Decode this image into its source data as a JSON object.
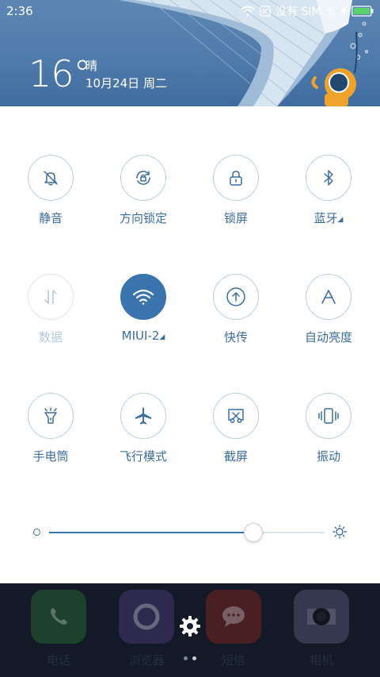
{
  "status_bar": {
    "time": "2:36",
    "carrier": "没有 SIM 卡"
  },
  "weather": {
    "temperature": "16°",
    "condition": "晴",
    "date": "10月24日 周二"
  },
  "toggles": [
    {
      "label": "静音",
      "icon": "bell-muted-icon",
      "state": "off"
    },
    {
      "label": "方向锁定",
      "icon": "rotation-lock-icon",
      "state": "off"
    },
    {
      "label": "锁屏",
      "icon": "lock-icon",
      "state": "off"
    },
    {
      "label": "蓝牙",
      "icon": "bluetooth-icon",
      "state": "off",
      "expandable": true
    },
    {
      "label": "数据",
      "icon": "mobile-data-icon",
      "state": "disabled"
    },
    {
      "label": "MIUI-2",
      "icon": "wifi-icon",
      "state": "on",
      "expandable": true
    },
    {
      "label": "快传",
      "icon": "share-upload-icon",
      "state": "off"
    },
    {
      "label": "自动亮度",
      "icon": "auto-brightness-icon",
      "state": "off"
    },
    {
      "label": "手电筒",
      "icon": "flashlight-icon",
      "state": "off"
    },
    {
      "label": "飞行模式",
      "icon": "airplane-icon",
      "state": "off"
    },
    {
      "label": "截屏",
      "icon": "screenshot-icon",
      "state": "off"
    },
    {
      "label": "振动",
      "icon": "vibrate-icon",
      "state": "off"
    }
  ],
  "brightness": {
    "level": 0.74
  },
  "dock": {
    "apps": [
      {
        "label": "电话",
        "icon": "phone-icon",
        "color": "#2f6a3e"
      },
      {
        "label": "浏览器",
        "icon": "browser-icon",
        "color": "#4b3f7a"
      },
      {
        "label": "短信",
        "icon": "message-icon",
        "color": "#7d2c2c"
      },
      {
        "label": "相机",
        "icon": "camera-icon",
        "color": "#5a5a7a"
      }
    ]
  },
  "colors": {
    "accent": "#3a74ae",
    "label": "#3a6e9f",
    "header_bg": "#4e7aaa"
  }
}
